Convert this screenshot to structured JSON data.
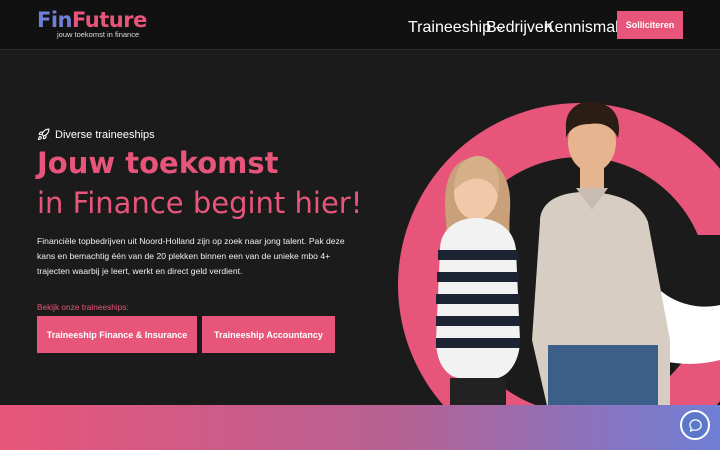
{
  "brand": {
    "logo_part1": "Fin",
    "logo_part2": "Future",
    "tagline": "jouw toekomst in finance",
    "pink": "#e8557a",
    "blue": "#6f7fd6"
  },
  "nav": {
    "items": [
      {
        "label": "Traineeship",
        "has_dropdown": true
      },
      {
        "label": "Bedrijven"
      },
      {
        "label": "Kennismaken"
      }
    ],
    "cta_label": "Solliciteren"
  },
  "hero": {
    "eyebrow_icon": "rocket-icon",
    "eyebrow": "Diverse traineeships",
    "title_line1": "Jouw toekomst",
    "title_line2": "in Finance begint hier!",
    "intro": "Financiële topbedrijven uit Noord-Holland zijn op zoek naar jong talent. Pak deze kans en bemachtig één van de 20 plekken binnen een van de unieke mbo 4+ trajecten waarbij je leert, werkt en direct geld verdient.",
    "prompt": "Bekijk onze traineeships:",
    "buttons": [
      {
        "label": "Traineeship Finance & Insurance"
      },
      {
        "label": "Traineeship Accountancy"
      }
    ]
  },
  "chat": {
    "icon": "chat-bubble-icon"
  }
}
